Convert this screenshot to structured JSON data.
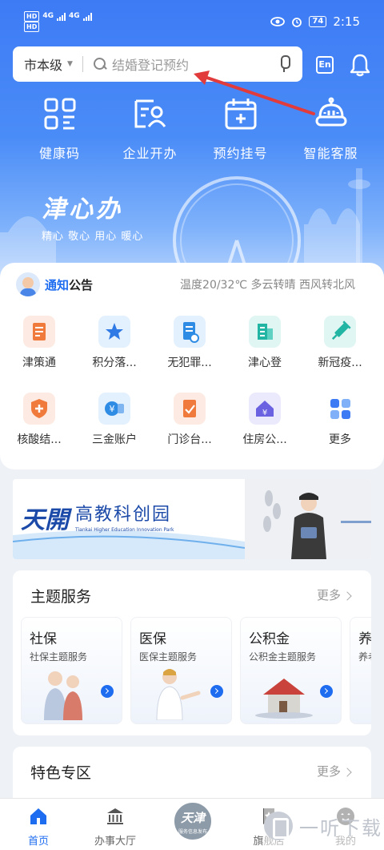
{
  "status_bar": {
    "hd1": "HD",
    "hd2": "HD",
    "net1": "4G",
    "net2": "4G",
    "battery": "74",
    "time": "2:15"
  },
  "search": {
    "city": "市本级",
    "placeholder": "结婚登记预约"
  },
  "lang_button": "En",
  "quick_actions": [
    {
      "label": "健康码",
      "icon": "qr-code-icon"
    },
    {
      "label": "企业开办",
      "icon": "enterprise-id-icon"
    },
    {
      "label": "预约挂号",
      "icon": "calendar-plus-icon"
    },
    {
      "label": "智能客服",
      "icon": "robot-icon"
    }
  ],
  "brand": {
    "title": "津心办",
    "subtitle": "精心 敬心 用心 暖心"
  },
  "notice": {
    "title_highlight": "通知",
    "title_rest": "公告",
    "weather": "温度20/32℃ 多云转晴 西风转北风"
  },
  "grid": [
    {
      "label": "津策通",
      "icon": "policy-doc-icon",
      "bg": "#fdebe3",
      "fg": "#f07a3c"
    },
    {
      "label": "积分落...",
      "icon": "star-badge-icon",
      "bg": "#e3f0fd",
      "fg": "#2f7ae5"
    },
    {
      "label": "无犯罪...",
      "icon": "certificate-icon",
      "bg": "#e3f0fd",
      "fg": "#2f8ce5"
    },
    {
      "label": "津心登",
      "icon": "building-icon",
      "bg": "#e0f6f3",
      "fg": "#22b5a3"
    },
    {
      "label": "新冠疫...",
      "icon": "syringe-icon",
      "bg": "#e0f6f3",
      "fg": "#22b5a3"
    },
    {
      "label": "核酸结...",
      "icon": "shield-plus-icon",
      "bg": "#fdebe3",
      "fg": "#f07a3c"
    },
    {
      "label": "三金账户",
      "icon": "yuan-card-icon",
      "bg": "#e3f0fd",
      "fg": "#2f8ce5"
    },
    {
      "label": "门诊台...",
      "icon": "clipboard-check-icon",
      "bg": "#fdebe3",
      "fg": "#f07a3c"
    },
    {
      "label": "住房公...",
      "icon": "house-yuan-icon",
      "bg": "#ebeafd",
      "fg": "#6a62e0"
    },
    {
      "label": "更多",
      "icon": "more-grid-icon",
      "bg": "#ffffff",
      "fg": "#3d7bf5"
    }
  ],
  "banner": {
    "logo_text": "天開",
    "title": "高教科创园",
    "subtitle": "Tiankai Higher Education Innovation Park"
  },
  "theme_services": {
    "title": "主题服务",
    "more": "更多",
    "cards": [
      {
        "title": "社保",
        "subtitle": "社保主题服务"
      },
      {
        "title": "医保",
        "subtitle": "医保主题服务"
      },
      {
        "title": "公积金",
        "subtitle": "公积金主题服务"
      },
      {
        "title": "养",
        "subtitle": "养老"
      }
    ]
  },
  "feature_zone": {
    "title": "特色专区",
    "more": "更多"
  },
  "bottom_nav": [
    {
      "label": "首页",
      "icon": "home-icon",
      "active": true
    },
    {
      "label": "办事大厅",
      "icon": "government-building-icon",
      "active": false
    },
    {
      "label": "",
      "icon": "tianjin-center-logo",
      "active": false
    },
    {
      "label": "旗舰店",
      "icon": "flag-store-icon",
      "active": false
    },
    {
      "label": "我的",
      "icon": "user-icon",
      "active": false
    }
  ],
  "center_logo": {
    "text": "天津",
    "sub": "服务信息发布"
  },
  "watermark": {
    "text": "一听下载"
  },
  "colors": {
    "primary": "#1e6cf0",
    "hero_top": "#3d7bf5",
    "arrow": "#e23b3b"
  }
}
